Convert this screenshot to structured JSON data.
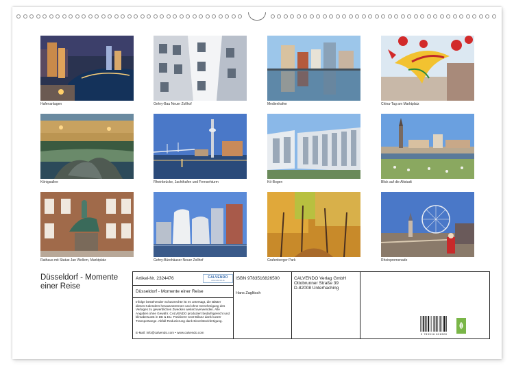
{
  "photos": [
    {
      "caption": "Hafenanlagen"
    },
    {
      "caption": "Gehry-Bau Neuer Zollhof"
    },
    {
      "caption": "Medienhafen"
    },
    {
      "caption": "China-Tag am Marktplatz"
    },
    {
      "caption": "Königsallee"
    },
    {
      "caption": "Rheinbrücke, Jachthafen und Fernsehturm"
    },
    {
      "caption": "Kö-Bogen"
    },
    {
      "caption": "Blick auf die Altstadt"
    },
    {
      "caption": "Rathaus mit Statue Jan Wellem, Marktplatz"
    },
    {
      "caption": "Gehry-Bürohäuser Neuer Zollhof"
    },
    {
      "caption": "Grafenberger Park"
    },
    {
      "caption": "Rheinpromenade"
    }
  ],
  "calendar": {
    "title_line1": "Düsseldorf - Momente",
    "title_line2": "einer Reise"
  },
  "info": {
    "article_no": "Artikel-Nr. 2324476",
    "logo": "CALVENDO",
    "logo_sub": "www.calvendo.de",
    "product_title": "Düsseldorf - Momente einer Reise",
    "legal_text": "Infolge bestehender Schutzrechte ist es untersagt, die Blätter dieses Kalenders herauszutrennen und ohne Genehmigung des Verlages zu gewerblichen Zwecken weiterzuverwenden. Alle Angaben ohne Gewähr. CALVENDO produziert bedarfsgerecht und klimabewusst in DE & EU. Positivere CO2-Bilanz dank kurzer Transportwege. Abfall-Reduzierung dank Einzelstückfertigung.",
    "email": "E-Mail: info@calvendo.com • www.calvendo.com",
    "isbn": "ISBN 9783516826500",
    "author": "Hans Zaglitsch",
    "publisher_line1": "CALVENDO Verlag GmbH",
    "publisher_line2": "Ottobrunner Straße 39",
    "publisher_line3": "D-82008 Unterhaching",
    "barcode_number": "9 783516 826500"
  },
  "icons": {
    "hanger": "hanger-hook-icon",
    "leaf": "eco-leaf-icon",
    "barcode": "barcode-icon"
  }
}
